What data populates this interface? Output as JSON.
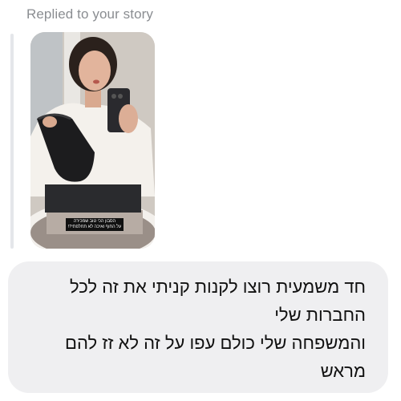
{
  "reply": {
    "label": "Replied to your story"
  },
  "story": {
    "caption_lines": [
      "הסבון הכי טוב שמכירה",
      "על החוף ואיכה לא תחלפתי?!"
    ]
  },
  "message": {
    "lines": [
      "חד משמעית רוצו לקנות קניתי את זה לכל",
      "החברות שלי",
      "והמשפחה שלי כולם עפו על זה לא זז להם",
      "מראש"
    ]
  },
  "colors": {
    "bubble_bg": "#efeff1",
    "label_text": "#8a8d91",
    "reply_bar": "#e4e6ea"
  }
}
